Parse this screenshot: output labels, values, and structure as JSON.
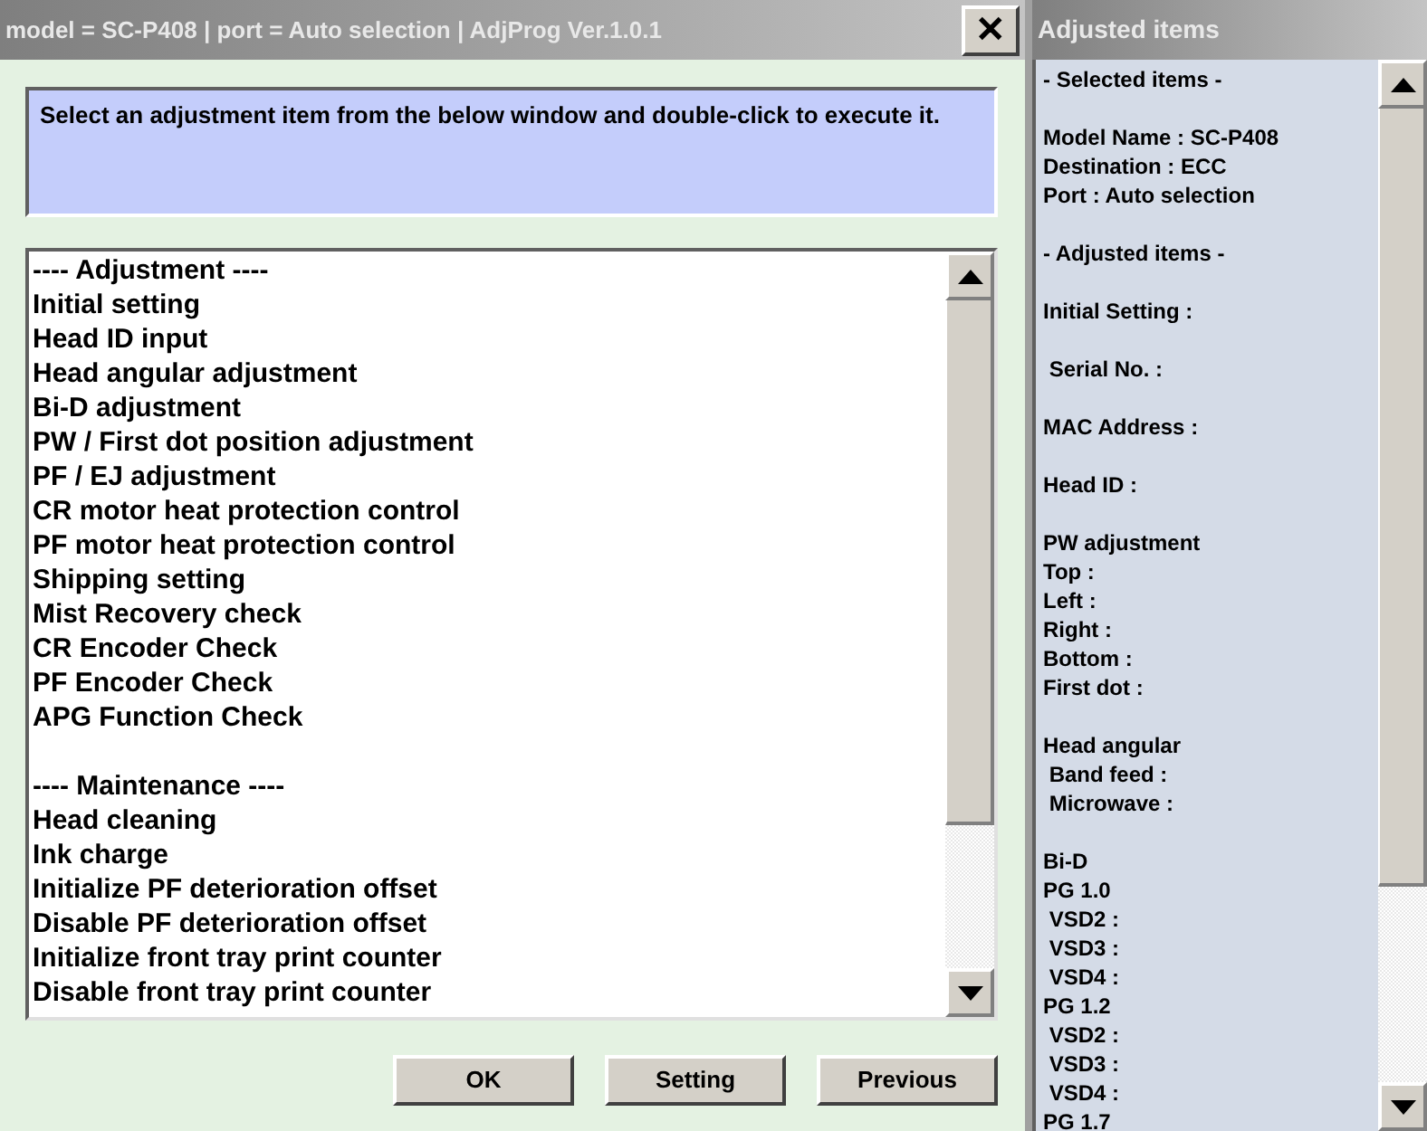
{
  "window": {
    "title": "model = SC-P408 | port = Auto selection | AdjProg Ver.1.0.1",
    "close": "✕"
  },
  "instruction": "Select an adjustment item from the below window and double-click to execute it.",
  "list": {
    "groups": [
      {
        "header": "---- Adjustment ----",
        "items": [
          "Initial setting",
          "Head ID input",
          "Head angular adjustment",
          "Bi-D adjustment",
          "PW / First dot position adjustment",
          "PF / EJ adjustment",
          "CR motor heat protection control",
          "PF motor heat protection control",
          "Shipping setting",
          "Mist Recovery check",
          "CR Encoder Check",
          "PF Encoder Check",
          "APG Function Check"
        ]
      },
      {
        "header": "---- Maintenance ----",
        "items": [
          "Head cleaning",
          "Ink charge",
          "Initialize PF deterioration offset",
          "Disable PF deterioration offset",
          "Initialize front tray print counter",
          "Disable front tray print counter"
        ]
      }
    ]
  },
  "buttons": [
    "OK",
    "Setting",
    "Previous"
  ],
  "side_panel": {
    "title": "Adjusted items",
    "blocks": [
      [
        "- Selected items -"
      ],
      [
        "Model Name : SC-P408",
        "Destination : ECC",
        "Port : Auto selection"
      ],
      [
        "- Adjusted items -"
      ],
      [
        "Initial Setting :"
      ],
      [
        " Serial No. :"
      ],
      [
        "MAC Address :"
      ],
      [
        "Head ID :"
      ],
      [
        "PW adjustment",
        "Top :",
        "Left :",
        "Right :",
        "Bottom :",
        "First dot :"
      ],
      [
        "Head angular",
        " Band feed :",
        " Microwave :"
      ],
      [
        "Bi-D",
        "PG 1.0",
        " VSD2 :",
        " VSD3 :",
        " VSD4 :",
        "PG 1.2",
        " VSD2 :",
        " VSD3 :",
        " VSD4 :",
        "PG 1.7"
      ]
    ]
  }
}
